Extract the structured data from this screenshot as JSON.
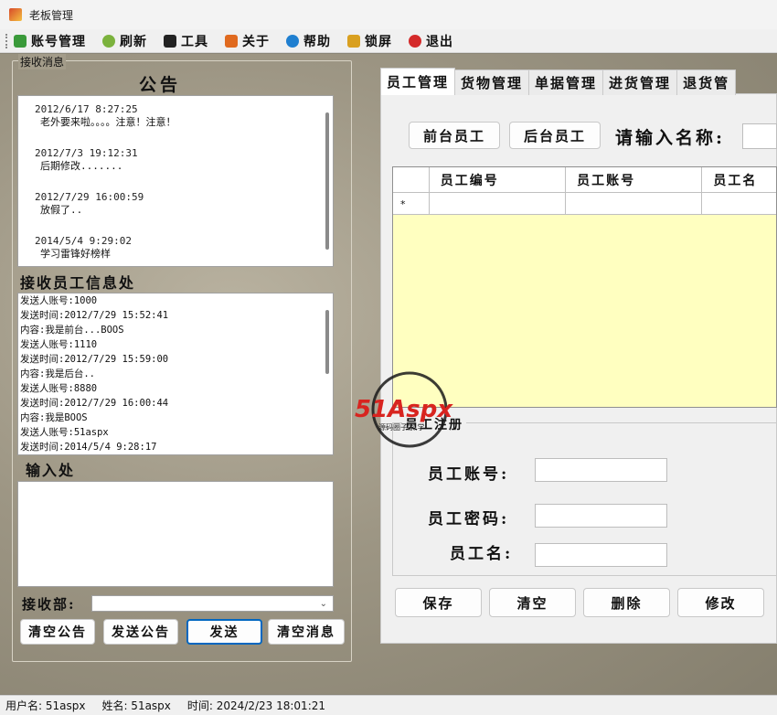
{
  "window": {
    "title": "老板管理"
  },
  "menu": [
    {
      "label": "账号管理",
      "icon": "account-icon",
      "color": "#3a9a3a"
    },
    {
      "label": "刷新",
      "icon": "refresh-icon",
      "color": "#7bb23d"
    },
    {
      "label": "工具",
      "icon": "tool-icon",
      "color": "#222222"
    },
    {
      "label": "关于",
      "icon": "about-icon",
      "color": "#e06a1f"
    },
    {
      "label": "帮助",
      "icon": "help-icon",
      "color": "#1f7fd0"
    },
    {
      "label": "锁屏",
      "icon": "lock-icon",
      "color": "#d9a020"
    },
    {
      "label": "退出",
      "icon": "exit-icon",
      "color": "#d42a2a"
    }
  ],
  "left": {
    "group_title": "接收消息",
    "announcement_heading": "公告",
    "announcements": [
      {
        "time": "2012/6/17 8:27:25",
        "text": "老外要来啦。。。。注意！注意！"
      },
      {
        "time": "2012/7/3 19:12:31",
        "text": "后期修改......."
      },
      {
        "time": "2012/7/29 16:00:59",
        "text": "放假了.."
      },
      {
        "time": "2014/5/4 9:29:02",
        "text": "学习雷锋好榜样"
      }
    ],
    "receive_heading": "接收员工信息处",
    "received": [
      "发送人账号:1000",
      "发送时间:2012/7/29 15:52:41",
      "内容:我是前台...BOOS",
      "发送人账号:1110",
      "发送时间:2012/7/29 15:59:00",
      "内容:我是后台..",
      "发送人账号:8880",
      "发送时间:2012/7/29 16:00:44",
      "内容:我是BOOS",
      "发送人账号:51aspx",
      "发送时间:2014/5/4 9:28:17"
    ],
    "input_heading": "输入处",
    "input_value": "",
    "receiver_label": "接收部:",
    "receiver_value": "",
    "buttons": {
      "clear_announcement": "清空公告",
      "send_announcement": "发送公告",
      "send": "发送",
      "clear_message": "清空消息"
    }
  },
  "right": {
    "tabs": [
      "员工管理",
      "货物管理",
      "单据管理",
      "进货管理",
      "退货管"
    ],
    "front_staff": "前台员工",
    "back_staff": "后台员工",
    "search_label": "请输入名称:",
    "search_value": "",
    "grid": {
      "columns": [
        "员工编号",
        "员工账号",
        "员工名"
      ],
      "new_row_marker": "*"
    },
    "register_legend": "员工注册",
    "fields": {
      "account_label": "员工账号:",
      "account_value": "",
      "password_label": "员工密码:",
      "password_value": "",
      "name_label": "员工名:",
      "name_value": ""
    },
    "actions": {
      "save": "保存",
      "clear": "清空",
      "delete": "删除",
      "modify": "修改"
    }
  },
  "watermark": {
    "brand": "51Aspx",
    "sub": "源码圈子家 学"
  },
  "status": {
    "user": "用户名: 51aspx",
    "name": "姓名: 51aspx",
    "time": "时间: 2024/2/23 18:01:21"
  }
}
